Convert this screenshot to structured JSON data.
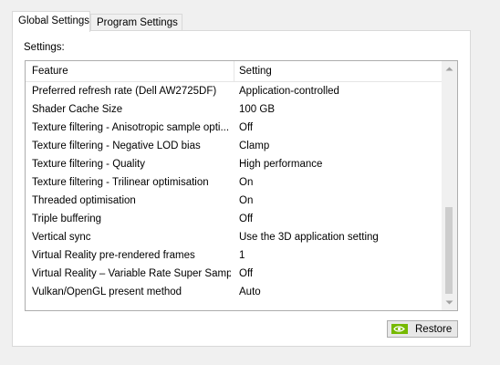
{
  "tabs": [
    {
      "label": "Global Settings",
      "active": true
    },
    {
      "label": "Program Settings",
      "active": false
    }
  ],
  "settings_label": "Settings:",
  "columns": {
    "feature": "Feature",
    "setting": "Setting"
  },
  "rows": [
    {
      "feature": "Preferred refresh rate (Dell AW2725DF)",
      "setting": "Application-controlled"
    },
    {
      "feature": "Shader Cache Size",
      "setting": "100 GB"
    },
    {
      "feature": "Texture filtering - Anisotropic sample opti...",
      "setting": "Off"
    },
    {
      "feature": "Texture filtering - Negative LOD bias",
      "setting": "Clamp"
    },
    {
      "feature": "Texture filtering - Quality",
      "setting": "High performance"
    },
    {
      "feature": "Texture filtering - Trilinear optimisation",
      "setting": "On"
    },
    {
      "feature": "Threaded optimisation",
      "setting": "On"
    },
    {
      "feature": "Triple buffering",
      "setting": "Off"
    },
    {
      "feature": "Vertical sync",
      "setting": "Use the 3D application setting"
    },
    {
      "feature": "Virtual Reality pre-rendered frames",
      "setting": "1"
    },
    {
      "feature": "Virtual Reality – Variable Rate Super Samp...",
      "setting": "Off"
    },
    {
      "feature": "Vulkan/OpenGL present method",
      "setting": "Auto"
    }
  ],
  "restore_button": {
    "label": "Restore",
    "icon": "nvidia-logo-icon"
  },
  "colors": {
    "nvidia_green": "#76b900"
  }
}
